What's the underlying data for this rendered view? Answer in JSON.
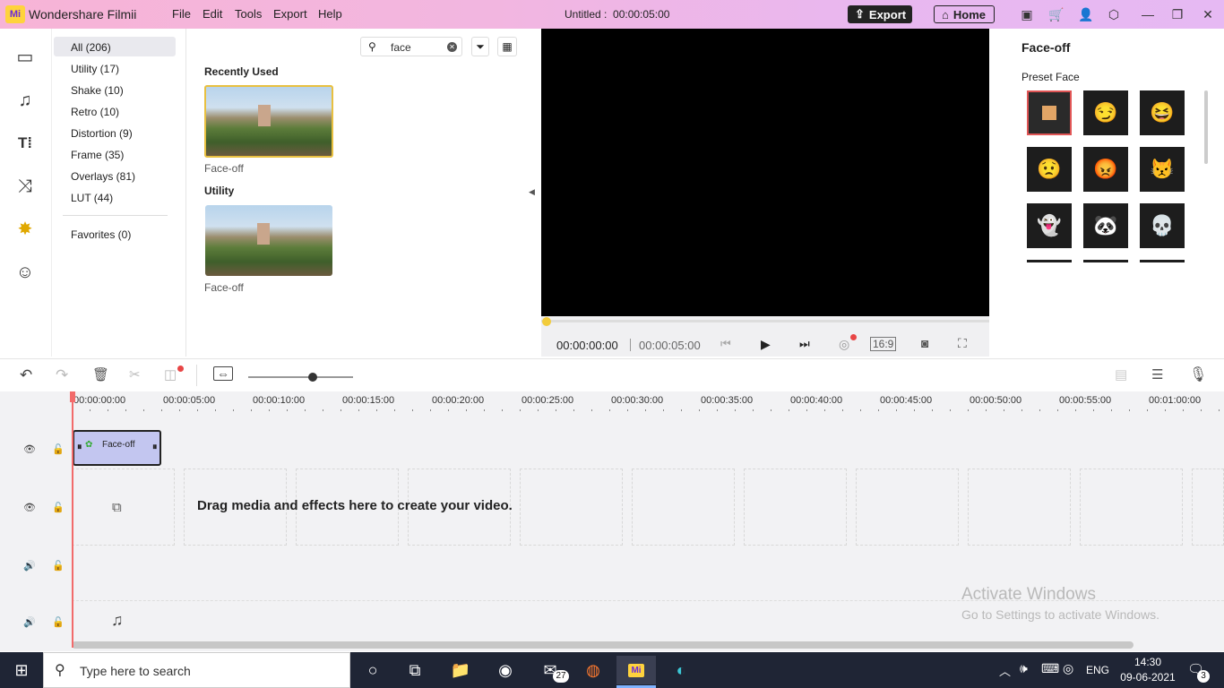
{
  "app": {
    "logo": "Mi",
    "name": "Wondershare Filmii",
    "menu": [
      "File",
      "Edit",
      "Tools",
      "Export",
      "Help"
    ],
    "doc_title": "Untitled :",
    "doc_duration": "00:00:05:00",
    "export_label": "Export",
    "home_label": "Home"
  },
  "categories": [
    {
      "label": "All (206)"
    },
    {
      "label": "Utility (17)"
    },
    {
      "label": "Shake (10)"
    },
    {
      "label": "Retro (10)"
    },
    {
      "label": "Distortion (9)"
    },
    {
      "label": "Frame (35)"
    },
    {
      "label": "Overlays (81)"
    },
    {
      "label": "LUT (44)"
    }
  ],
  "favorites": "Favorites (0)",
  "search": {
    "value": "face"
  },
  "media": {
    "recent_heading": "Recently Used",
    "recent_item": "Face-off",
    "utility_heading": "Utility",
    "utility_item": "Face-off"
  },
  "player": {
    "current": "00:00:00:00",
    "total": "00:00:05:00",
    "ratio": "16:9"
  },
  "right_panel": {
    "title": "Face-off",
    "subtitle": "Preset Face"
  },
  "timeline": {
    "ticks": [
      "00:00:00:00",
      "00:00:05:00",
      "00:00:10:00",
      "00:00:15:00",
      "00:00:20:00",
      "00:00:25:00",
      "00:00:30:00",
      "00:00:35:00",
      "00:00:40:00",
      "00:00:45:00",
      "00:00:50:00",
      "00:00:55:00",
      "00:01:00:00"
    ],
    "clip_label": "Face-off",
    "drop_hint": "Drag media and effects here to create your video."
  },
  "watermark": {
    "line1": "Activate Windows",
    "line2": "Go to Settings to activate Windows."
  },
  "taskbar": {
    "search_placeholder": "Type here to search",
    "mail_badge": "27",
    "lang": "ENG",
    "time": "14:30",
    "date": "09-06-2021",
    "notif_count": "3"
  },
  "colors": {
    "accent_yellow": "#ffd33d",
    "clip": "#c3c6f0",
    "playhead": "#f26b6b"
  }
}
